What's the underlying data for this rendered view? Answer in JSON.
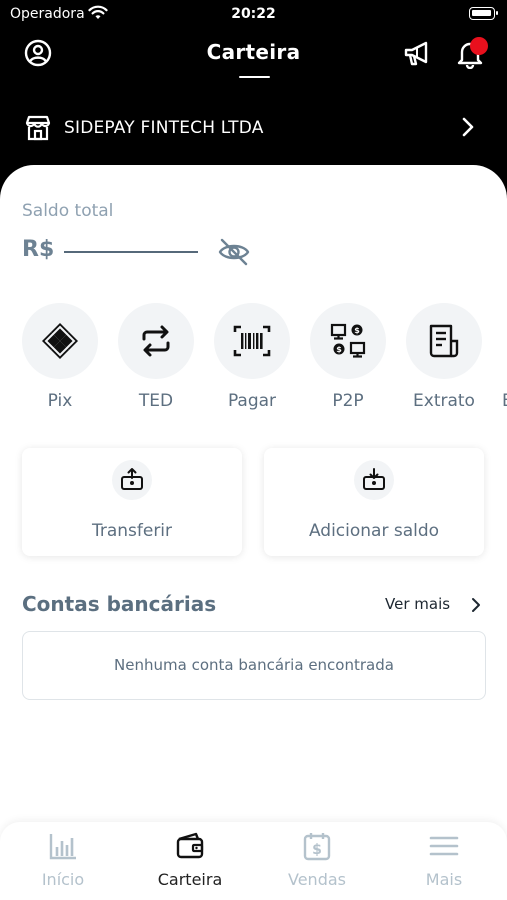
{
  "status_bar": {
    "carrier": "Operadora",
    "time": "20:22"
  },
  "header": {
    "title": "Carteira"
  },
  "merchant": {
    "name": "SIDEPAY FINTECH LTDA"
  },
  "balance": {
    "label": "Saldo total",
    "currency": "R$"
  },
  "actions": [
    {
      "label": "Pix",
      "icon": "pix-icon"
    },
    {
      "label": "TED",
      "icon": "transfer-arrows-icon"
    },
    {
      "label": "Pagar",
      "icon": "barcode-icon"
    },
    {
      "label": "P2P",
      "icon": "p2p-icon"
    },
    {
      "label": "Extrato",
      "icon": "receipt-icon"
    }
  ],
  "cards": {
    "transfer_label": "Transferir",
    "add_balance_label": "Adicionar saldo"
  },
  "bank_accounts": {
    "title": "Contas bancárias",
    "see_more": "Ver mais",
    "empty_message": "Nenhuma conta bancária encontrada"
  },
  "bottom_nav": [
    {
      "label": "Início",
      "icon": "chart-icon",
      "active": false
    },
    {
      "label": "Carteira",
      "icon": "wallet-icon",
      "active": true
    },
    {
      "label": "Vendas",
      "icon": "calendar-dollar-icon",
      "active": false
    },
    {
      "label": "Mais",
      "icon": "menu-icon",
      "active": false
    }
  ],
  "colors": {
    "header_bg": "#000000",
    "notification_dot": "#e8101d",
    "muted_text": "#8fa1b1"
  }
}
